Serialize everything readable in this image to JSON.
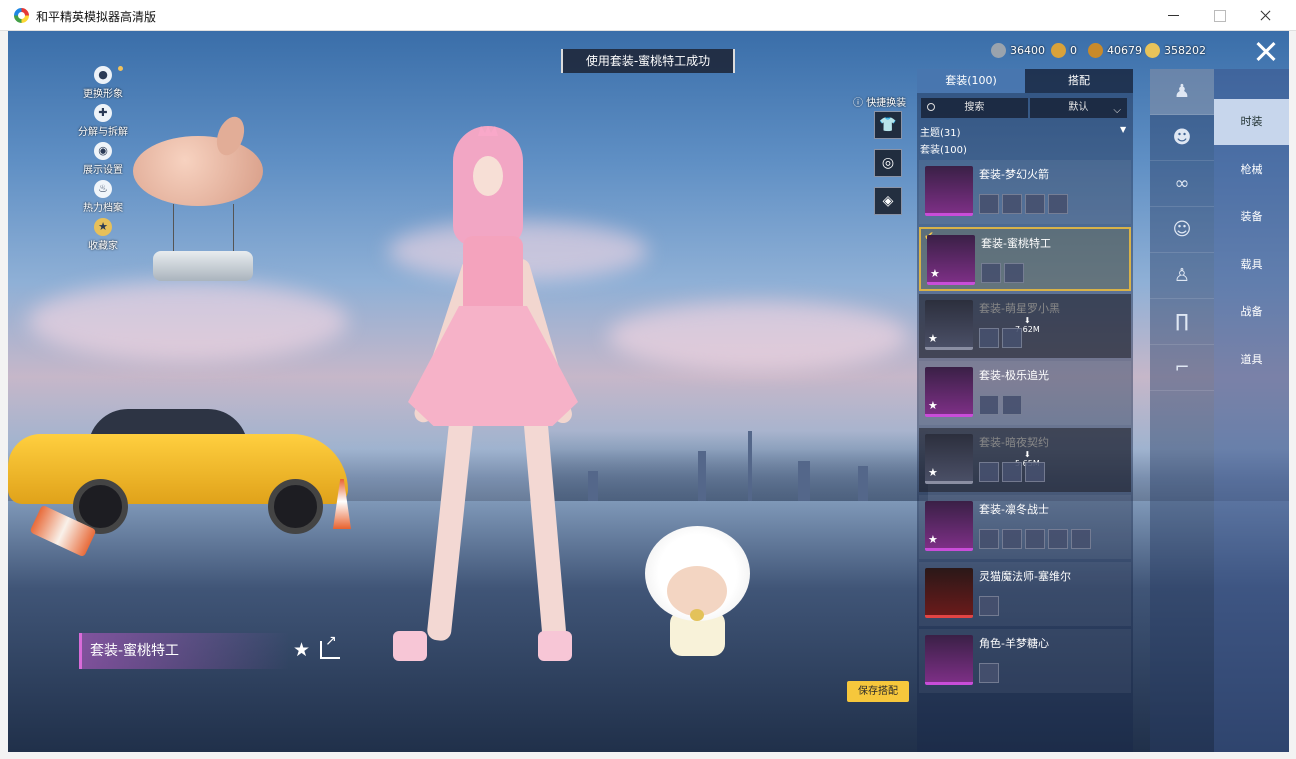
{
  "window": {
    "title": "和平精英模拟器高清版"
  },
  "toast": "使用套装-蜜桃特工成功",
  "currency": [
    {
      "value": "36400",
      "color": "#9aa3ad"
    },
    {
      "value": "0",
      "color": "#d9a23a"
    },
    {
      "value": "40679",
      "color": "#c98a2a"
    },
    {
      "value": "358202",
      "color": "#e8c35a"
    }
  ],
  "left_menu": [
    {
      "label": "更换形象",
      "icon": "person-icon"
    },
    {
      "label": "分解与拆解",
      "icon": "puzzle-icon"
    },
    {
      "label": "展示设置",
      "icon": "eye-icon"
    },
    {
      "label": "热力档案",
      "icon": "flame-icon"
    },
    {
      "label": "收藏家",
      "icon": "medal-icon"
    }
  ],
  "quick_change": {
    "label": "快捷换装"
  },
  "panel": {
    "tabs": [
      "套装(100)",
      "搭配"
    ],
    "search_placeholder": "搜索",
    "sort": "默认",
    "theme_line": "主题(31)",
    "outfit_line": "套装(100)"
  },
  "outfits": [
    {
      "name": "套装-梦幻火箭",
      "items": 4,
      "state": "normal",
      "theme": "purple"
    },
    {
      "name": "套装-蜜桃特工",
      "items": 2,
      "state": "selected",
      "theme": "purple"
    },
    {
      "name": "套装-萌星罗小黑",
      "items": 2,
      "state": "locked",
      "download": "7.62M",
      "theme": "plain"
    },
    {
      "name": "套装-极乐追光",
      "items": 2,
      "state": "normal",
      "theme": "purple"
    },
    {
      "name": "套装-暗夜契约",
      "items": 3,
      "state": "locked",
      "download": "5.65M",
      "theme": "plain"
    },
    {
      "name": "套装-凛冬战士",
      "items": 5,
      "state": "normal",
      "theme": "purple"
    },
    {
      "name": "灵猫魔法师-塞维尔",
      "items": 1,
      "state": "normal",
      "theme": "red"
    },
    {
      "name": "角色-羊梦糖心",
      "items": 1,
      "state": "normal",
      "theme": "purple"
    }
  ],
  "categories": [
    "时装",
    "枪械",
    "装备",
    "载具",
    "战备",
    "道具"
  ],
  "rail_icons": [
    "outfit-icon",
    "character-icon",
    "glasses-icon",
    "mask-icon",
    "top-icon",
    "pants-icon",
    "shoes-icon"
  ],
  "current_outfit": "套装-蜜桃特工",
  "save_button": "保存搭配"
}
